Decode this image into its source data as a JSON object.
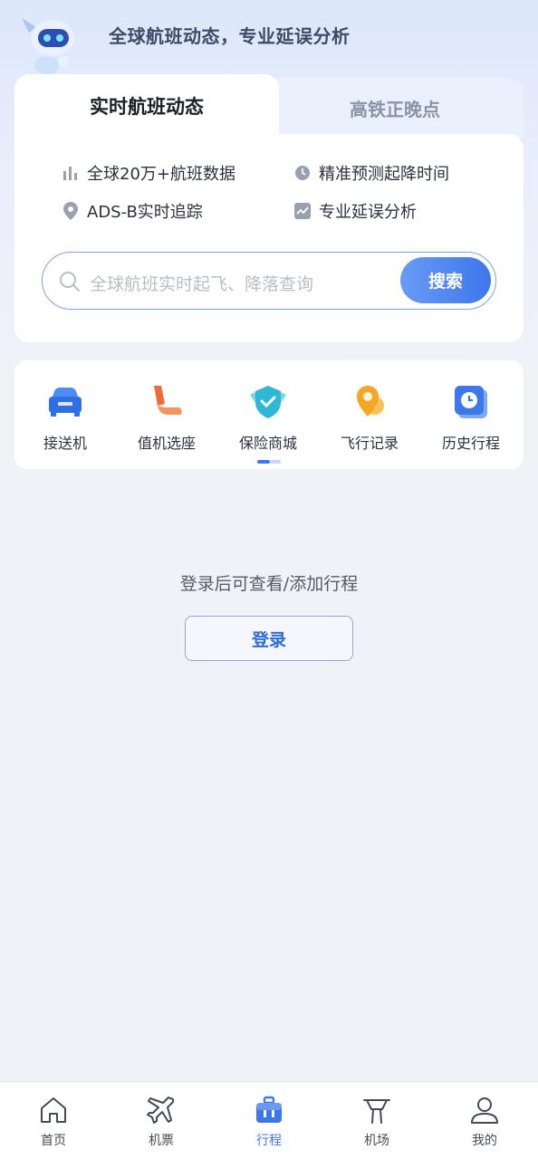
{
  "header": {
    "slogan": "全球航班动态，专业延误分析"
  },
  "search_card": {
    "tabs": [
      {
        "label": "实时航班动态",
        "active": true
      },
      {
        "label": "高铁正晚点",
        "active": false
      }
    ],
    "features": [
      {
        "icon": "bar-chart-icon",
        "label": "全球20万+航班数据"
      },
      {
        "icon": "clock-icon",
        "label": "精准预测起降时间"
      },
      {
        "icon": "location-pin-icon",
        "label": "ADS-B实时追踪"
      },
      {
        "icon": "trend-chart-icon",
        "label": "专业延误分析"
      }
    ],
    "search": {
      "placeholder": "全球航班实时起飞、降落查询",
      "button_label": "搜索"
    }
  },
  "services": [
    {
      "icon": "car-icon",
      "label": "接送机"
    },
    {
      "icon": "seat-icon",
      "label": "值机选座"
    },
    {
      "icon": "shield-icon",
      "label": "保险商城"
    },
    {
      "icon": "map-pin-icon",
      "label": "飞行记录"
    },
    {
      "icon": "history-clock-icon",
      "label": "历史行程"
    }
  ],
  "trips": {
    "empty_message": "登录后可查看/添加行程",
    "login_button": "登录"
  },
  "tabbar": [
    {
      "icon": "home-icon",
      "label": "首页",
      "active": false
    },
    {
      "icon": "airplane-icon",
      "label": "机票",
      "active": false
    },
    {
      "icon": "suitcase-icon",
      "label": "行程",
      "active": true
    },
    {
      "icon": "airport-tower-icon",
      "label": "机场",
      "active": false
    },
    {
      "icon": "person-icon",
      "label": "我的",
      "active": false
    }
  ],
  "colors": {
    "accent": "#3d77ec",
    "background": "#f0f2f7",
    "seat_orange": "#f06a3c",
    "shield_teal": "#2fb8d6",
    "pin_orange": "#f5a623"
  }
}
